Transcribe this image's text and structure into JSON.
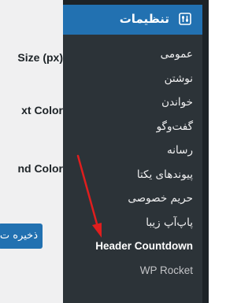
{
  "content": {
    "labels": [
      "Size (px)",
      "xt Color",
      "nd Color"
    ],
    "save_button": "ذخیره ت"
  },
  "sidebar": {
    "menu_title": "تنظیمات",
    "menu_icon": "settings-sliders-icon",
    "items": [
      {
        "label": "عمومی"
      },
      {
        "label": "نوشتن"
      },
      {
        "label": "خواندن"
      },
      {
        "label": "گفت‌وگو"
      },
      {
        "label": "رسانه"
      },
      {
        "label": "پیوندهای یکتا"
      },
      {
        "label": "حریم خصوصی"
      },
      {
        "label": "پاپ‌آپ زیبا"
      },
      {
        "label": "Header Countdown"
      },
      {
        "label": "WP Rocket"
      }
    ]
  },
  "colors": {
    "sidebar_bg": "#2c3338",
    "accent": "#2271b1",
    "arrow": "#e01e1e"
  }
}
